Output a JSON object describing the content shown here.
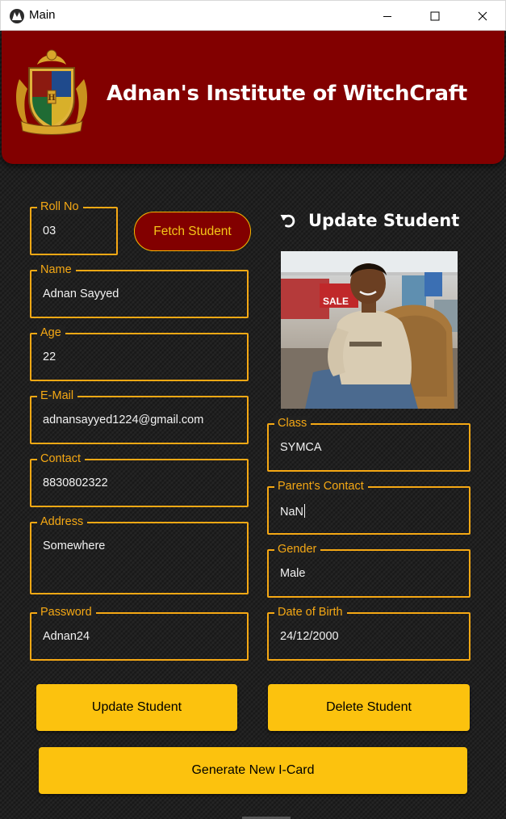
{
  "window": {
    "title": "Main"
  },
  "header": {
    "title": "Adnan's Institute of WitchCraft"
  },
  "fetch_button": "Fetch Student",
  "section_title": "Update Student",
  "fields": {
    "roll_no": {
      "label": "Roll No",
      "value": "03"
    },
    "name": {
      "label": "Name",
      "value": "Adnan Sayyed"
    },
    "age": {
      "label": "Age",
      "value": "22"
    },
    "email": {
      "label": "E-Mail",
      "value": "adnansayyed1224@gmail.com"
    },
    "contact": {
      "label": "Contact",
      "value": "8830802322"
    },
    "address": {
      "label": "Address",
      "value": "Somewhere"
    },
    "password": {
      "label": "Password",
      "value": "Adnan24"
    },
    "class": {
      "label": "Class",
      "value": "SYMCA"
    },
    "parents_contact": {
      "label": "Parent's Contact",
      "value": "NaN"
    },
    "gender": {
      "label": "Gender",
      "value": "Male"
    },
    "dob": {
      "label": "Date of Birth",
      "value": "24/12/2000"
    }
  },
  "photo": {
    "sign_text": "SALE"
  },
  "buttons": {
    "update": "Update Student",
    "delete": "Delete Student",
    "generate": "Generate New I-Card"
  },
  "colors": {
    "header_bg": "#820000",
    "accent": "#f5a814",
    "button_yellow": "#fcc20e",
    "body_bg": "#202020"
  },
  "icons": [
    "app-icon",
    "minimize-icon",
    "maximize-icon",
    "close-icon",
    "crest-logo",
    "undo-icon"
  ]
}
